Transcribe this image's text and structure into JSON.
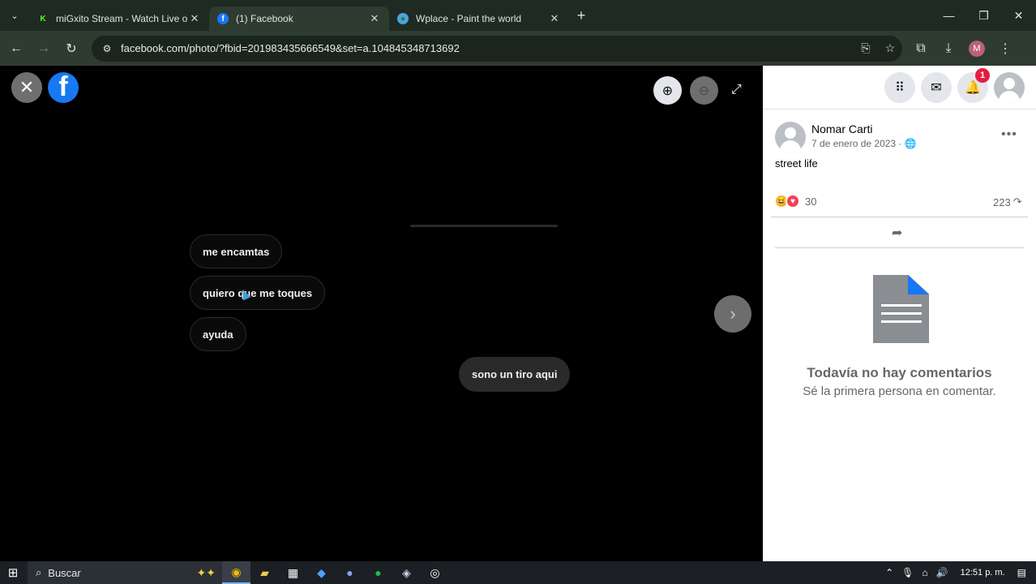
{
  "browser": {
    "tabs": [
      {
        "title": "miGxito Stream - Watch Live on",
        "favicon": "kick-icon",
        "color": "#53fc18"
      },
      {
        "title": "(1) Facebook",
        "favicon": "facebook-icon",
        "color": "#1877f2"
      },
      {
        "title": "Wplace - Paint the world",
        "favicon": "globe-icon",
        "color": "#4aa3df"
      }
    ],
    "url": "facebook.com/photo/?fbid=201983435666549&set=a.104845348713692",
    "profile_initial": "M"
  },
  "viewer": {
    "chips": [
      "me encamtas",
      "quiero que me toques",
      "ayuda"
    ],
    "bubble": "sono un tiro aqui"
  },
  "panel": {
    "notification_count": "1",
    "post": {
      "author": "Nomar Carti",
      "date": "7 de enero de 2023 · 🌐",
      "caption": "street life",
      "reaction_count": "30",
      "share_count": "223"
    },
    "empty_comments": {
      "title": "Todavía no hay comentarios",
      "subtitle": "Sé la primera persona en comentar."
    }
  },
  "taskbar": {
    "search_placeholder": "Buscar",
    "clock": "12:51 p. m."
  }
}
